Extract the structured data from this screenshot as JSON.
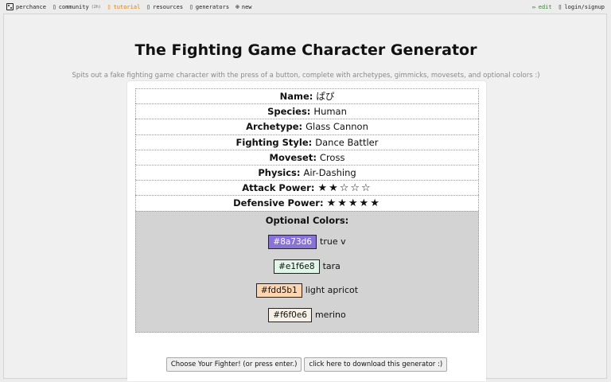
{
  "nav": {
    "left": [
      {
        "label": "perchance",
        "icon": "dice-icon"
      },
      {
        "label": "community",
        "badge": "(2h)",
        "icon": "chat-icon"
      },
      {
        "label": "tutorial",
        "icon": "book-icon"
      },
      {
        "label": "resources",
        "icon": "doc-icon"
      },
      {
        "label": "generators",
        "icon": "list-icon"
      },
      {
        "label": "new",
        "icon": "plus-circle-icon"
      }
    ],
    "right": [
      {
        "label": "edit",
        "icon": "pencil-icon"
      },
      {
        "label": "login/signup",
        "icon": "person-icon"
      }
    ]
  },
  "page": {
    "title": "The Fighting Game Character Generator",
    "subtitle": "Spits out a fake fighting game character with the press of a button, complete with archetypes, gimmicks, movesets, and optional colors :)"
  },
  "character": {
    "name_label": "Name:",
    "name_value": "ぱぴ",
    "species_label": "Species:",
    "species_value": "Human",
    "archetype_label": "Archetype:",
    "archetype_value": "Glass Cannon",
    "style_label": "Fighting Style:",
    "style_value": "Dance Battler",
    "moveset_label": "Moveset:",
    "moveset_value": "Cross",
    "physics_label": "Physics:",
    "physics_value": "Air-Dashing",
    "attack_label": "Attack Power:",
    "attack_stars": "★★☆☆☆",
    "attack_rating": 2,
    "defense_label": "Defensive Power:",
    "defense_stars": "★★★★★",
    "defense_rating": 5
  },
  "colors": {
    "title": "Optional Colors:",
    "items": [
      {
        "hex": "#8a73d6",
        "name": "true v",
        "bg": "#8a73d6",
        "text": "#ffffff"
      },
      {
        "hex": "#e1f6e8",
        "name": "tara",
        "bg": "#e1f6e8",
        "text": "#111111"
      },
      {
        "hex": "#fdd5b1",
        "name": "light apricot",
        "bg": "#fdd5b1",
        "text": "#111111"
      },
      {
        "hex": "#f6f0e6",
        "name": "merino",
        "bg": "#f6f0e6",
        "text": "#111111"
      }
    ]
  },
  "buttons": {
    "generate": "Choose Your Fighter! (or press enter.)",
    "download": "click here to download this generator :)"
  }
}
